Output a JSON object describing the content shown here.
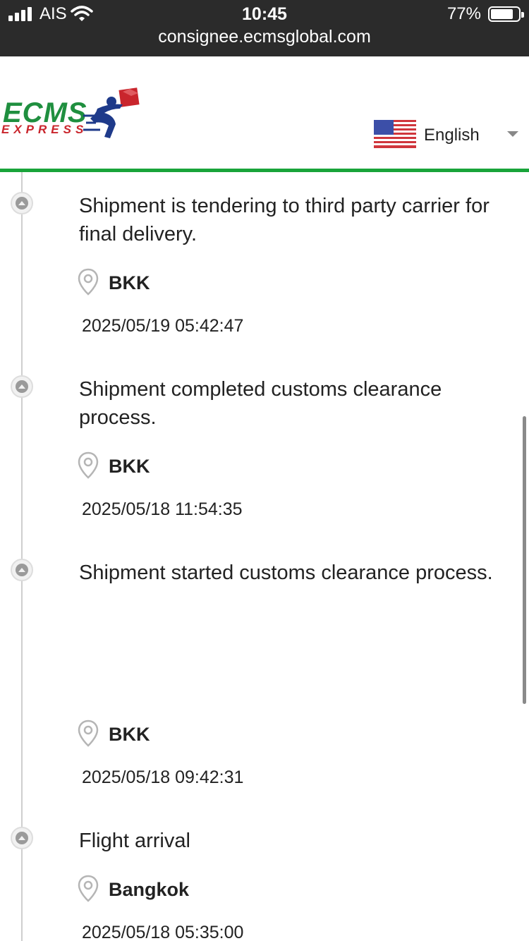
{
  "status_bar": {
    "carrier": "AIS",
    "time": "10:45",
    "battery": "77%",
    "battery_level": 0.77,
    "url": "consignee.ecmsglobal.com"
  },
  "header": {
    "logo_text": "ECMS",
    "logo_subtext": "EXPRESS",
    "language": "English",
    "flag_icon": "us-flag-icon",
    "accent_color": "#19a43a"
  },
  "events": [
    {
      "description": "Shipment is tendering to third party carrier for final delivery.",
      "location": "BKK",
      "timestamp": "2025/05/19 05:42:47"
    },
    {
      "description": "Shipment completed customs clearance process.",
      "location": "BKK",
      "timestamp": "2025/05/18 11:54:35"
    },
    {
      "description": "Shipment started customs clearance process.",
      "location": "BKK",
      "timestamp": "2025/05/18 09:42:31"
    },
    {
      "description": "Flight arrival",
      "location": "Bangkok",
      "timestamp": "2025/05/18 05:35:00"
    }
  ]
}
